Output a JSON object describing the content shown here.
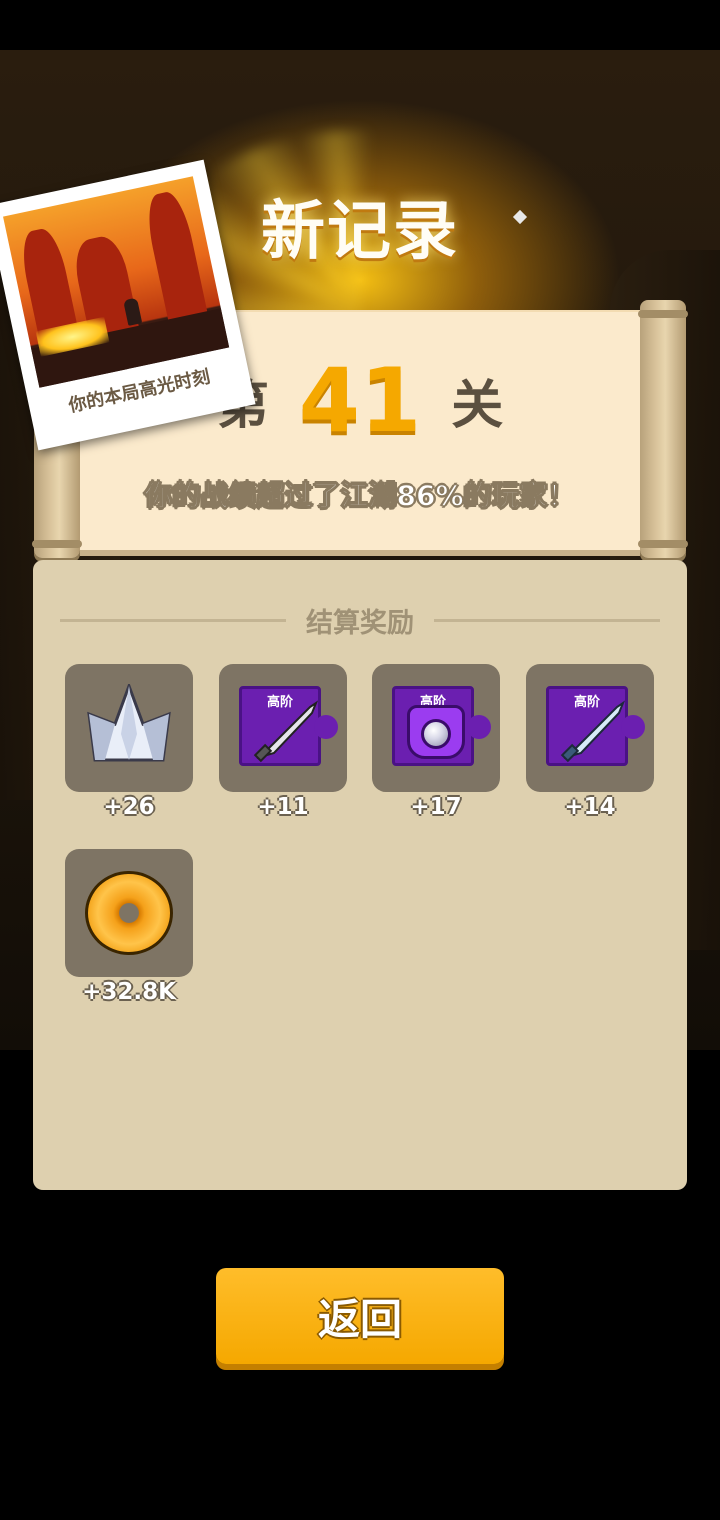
{
  "header": {
    "title": "新记录"
  },
  "highlight": {
    "caption": "你的本局高光时刻"
  },
  "level": {
    "prefix": "第",
    "number": "41",
    "suffix": "关"
  },
  "stats": {
    "text": "你的战绩超过了江湖86%的玩家！"
  },
  "rewards": {
    "header": "结算奖励",
    "items": [
      {
        "icon": "crystal-shard-icon",
        "count": "+26"
      },
      {
        "icon": "blade-puzzle-icon",
        "grade": "高阶",
        "count": "+11"
      },
      {
        "icon": "gem-armor-puzzle-icon",
        "grade": "高阶",
        "count": "+17"
      },
      {
        "icon": "blue-blade-puzzle-icon",
        "grade": "高阶",
        "count": "+14"
      },
      {
        "icon": "gold-coin-icon",
        "count": "+32.8K"
      }
    ]
  },
  "actions": {
    "return_label": "返回"
  },
  "colors": {
    "accent": "#f5a800",
    "panel": "#ded0af",
    "scroll": "#fbeacc",
    "puzzle": "#6b1fb0"
  }
}
